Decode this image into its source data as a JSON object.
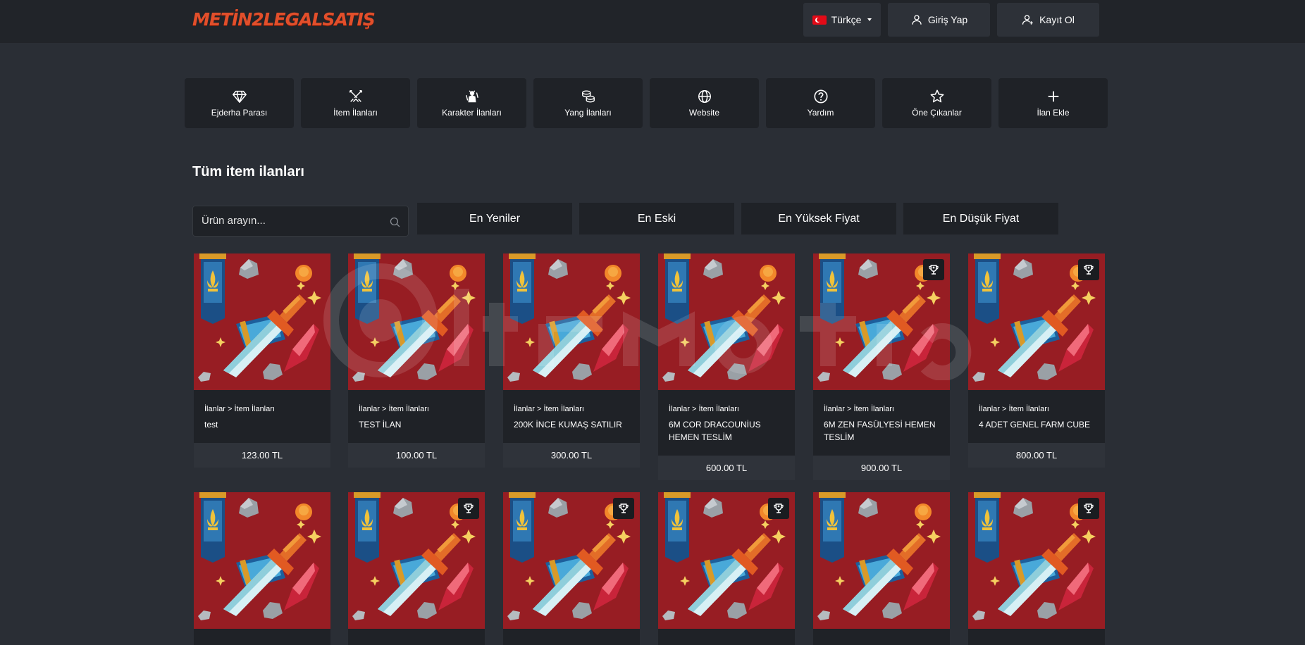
{
  "header": {
    "logo": "METİN2LEGALSATIŞ",
    "language": "Türkçe",
    "login": "Giriş Yap",
    "register": "Kayıt Ol"
  },
  "categories": [
    {
      "label": "Ejderha Parası",
      "icon": "diamond-icon"
    },
    {
      "label": "İtem İlanları",
      "icon": "crossed-swords-icon"
    },
    {
      "label": "Karakter İlanları",
      "icon": "character-icon"
    },
    {
      "label": "Yang İlanları",
      "icon": "coins-icon"
    },
    {
      "label": "Website",
      "icon": "globe-icon"
    },
    {
      "label": "Yardım",
      "icon": "help-icon"
    },
    {
      "label": "Öne Çıkanlar",
      "icon": "star-icon"
    },
    {
      "label": "İlan Ekle",
      "icon": "plus-icon"
    }
  ],
  "section": {
    "title": "Tüm item ilanları",
    "search_placeholder": "Ürün arayın..."
  },
  "sort": [
    "En Yeniler",
    "En Eski",
    "En Yüksek Fiyat",
    "En Düşük Fiyat"
  ],
  "listings": [
    {
      "breadcrumb": "İlanlar > İtem İlanları",
      "title": "test",
      "price": "123.00 TL",
      "featured": false
    },
    {
      "breadcrumb": "İlanlar > İtem İlanları",
      "title": "TEST İLAN",
      "price": "100.00 TL",
      "featured": false
    },
    {
      "breadcrumb": "İlanlar > İtem İlanları",
      "title": "200K İNCE KUMAŞ SATILIR",
      "price": "300.00 TL",
      "featured": false
    },
    {
      "breadcrumb": "İlanlar > İtem İlanları",
      "title": "6M COR DRACOUNİUS HEMEN TESLİM",
      "price": "600.00 TL",
      "featured": false
    },
    {
      "breadcrumb": "İlanlar > İtem İlanları",
      "title": "6M ZEN FASÜLYESİ HEMEN TESLİM",
      "price": "900.00 TL",
      "featured": true
    },
    {
      "breadcrumb": "İlanlar > İtem İlanları",
      "title": "4 ADET GENEL FARM CUBE",
      "price": "800.00 TL",
      "featured": true
    },
    {
      "featured": false
    },
    {
      "featured": true
    },
    {
      "featured": true
    },
    {
      "featured": true
    },
    {
      "featured": false
    },
    {
      "featured": true
    }
  ]
}
